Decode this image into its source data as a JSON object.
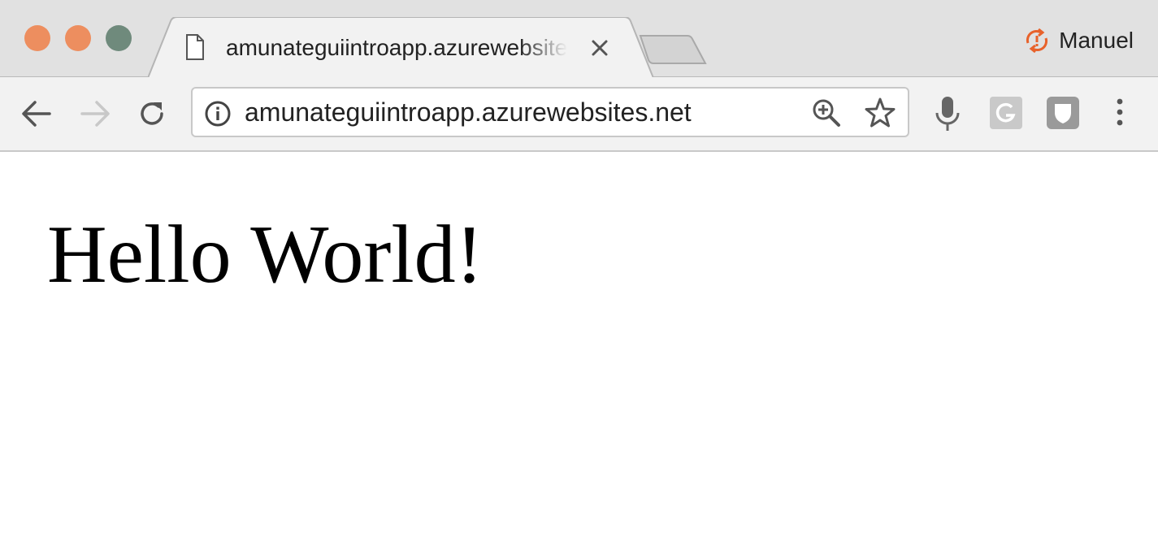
{
  "window": {
    "tab": {
      "title": "amunateguiintroapp.azurewebsites.net",
      "icon": "document-icon"
    },
    "profile": {
      "name": "Manuel",
      "icon": "sync-error-icon",
      "accent": "#e8622b"
    },
    "traffic_colors": {
      "close": "#ed8e5f",
      "minimize": "#ed8e5f",
      "maximize": "#6f8a7c"
    }
  },
  "toolbar": {
    "address": "amunateguiintroapp.azurewebsites.net",
    "icons": [
      "back-arrow-icon",
      "forward-arrow-icon",
      "reload-icon",
      "info-icon",
      "zoom-icon",
      "star-icon",
      "microphone-icon",
      "google-extension-icon",
      "extension-icon",
      "menu-icon"
    ]
  },
  "page": {
    "heading": "Hello World!"
  }
}
